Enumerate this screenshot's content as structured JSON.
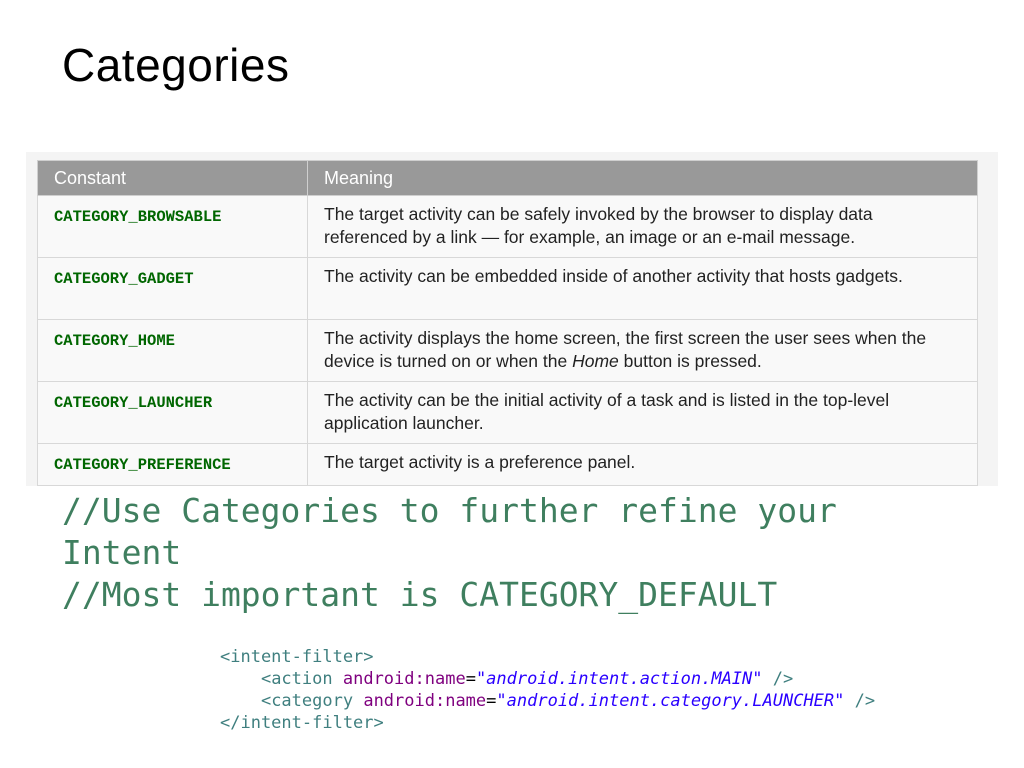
{
  "slide": {
    "title": "Categories"
  },
  "table": {
    "headers": [
      "Constant",
      "Meaning"
    ],
    "rows": [
      {
        "constant": "CATEGORY_BROWSABLE",
        "meaning": "The target activity can be safely invoked by the browser to display data referenced by a link — for example, an image or an e-mail message."
      },
      {
        "constant": "CATEGORY_GADGET",
        "meaning": "The activity can be embedded inside of another activity that hosts gadgets."
      },
      {
        "constant": "CATEGORY_HOME",
        "meaning_before": "The activity displays the home screen, the first screen the user sees when the device is turned on or when the ",
        "meaning_em": "Home",
        "meaning_after": " button is pressed."
      },
      {
        "constant": "CATEGORY_LAUNCHER",
        "meaning": "The activity can be the initial activity of a task and is listed in the top-level application launcher."
      },
      {
        "constant": "CATEGORY_PREFERENCE",
        "meaning": "The target activity is a preference panel."
      }
    ]
  },
  "comments": {
    "line1": "//Use Categories to further refine your Intent",
    "line2": "//Most important is CATEGORY_DEFAULT"
  },
  "code": {
    "open_tag": "<intent-filter>",
    "action_tag": "<action",
    "action_attr": "android:name",
    "action_value": "\"android.intent.action.MAIN\"",
    "category_tag": "<category",
    "category_attr": "android:name",
    "category_value": "\"android.intent.category.LAUNCHER\"",
    "self_close": "/>",
    "equals": "=",
    "close_tag": "</intent-filter>"
  }
}
